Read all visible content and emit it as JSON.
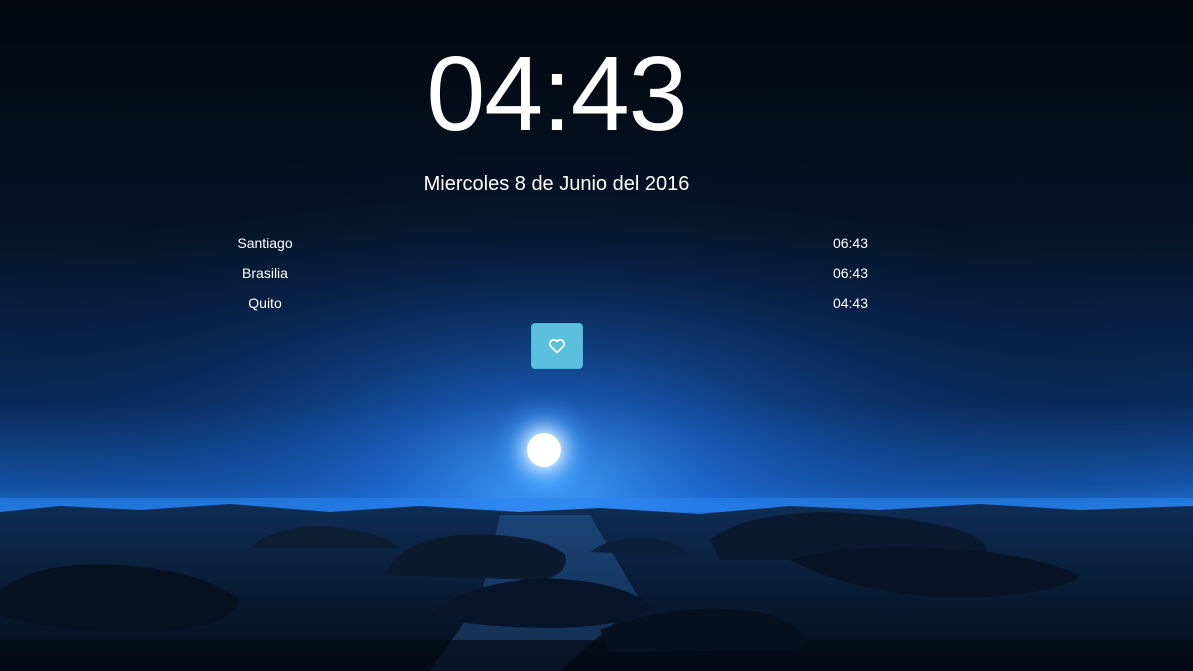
{
  "clock": {
    "time": "04:43",
    "date": "Miercoles 8 de Junio del 2016"
  },
  "zones": [
    {
      "city": "Santiago",
      "time": "06:43"
    },
    {
      "city": "Brasilia",
      "time": "06:43"
    },
    {
      "city": "Quito",
      "time": "04:43"
    }
  ],
  "favorite_button": {
    "icon": "heart-icon",
    "color": "#5bc0de"
  },
  "colors": {
    "text": "#ffffff",
    "sky_top": "#03070f",
    "glow": "#1e78e6",
    "moon": "#ffffff"
  }
}
